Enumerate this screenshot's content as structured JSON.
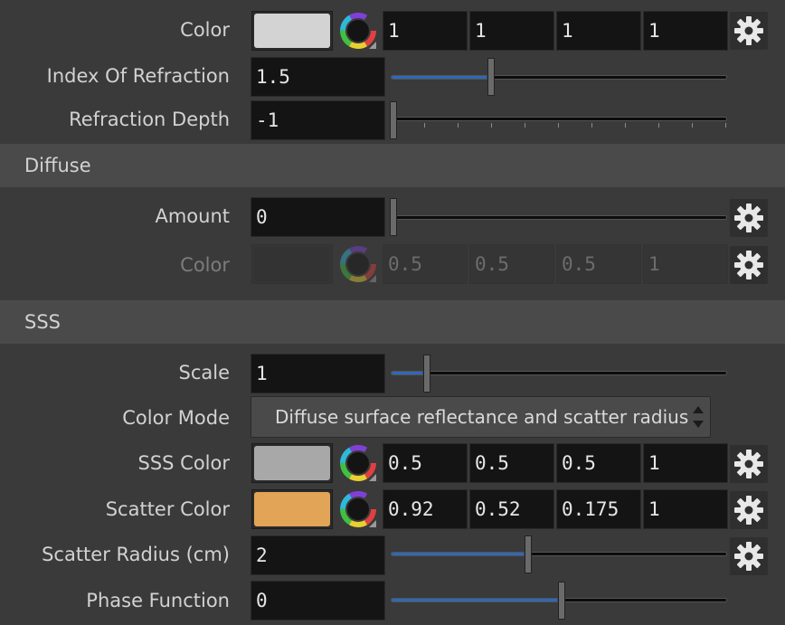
{
  "colors": {
    "field_bg": "#141414",
    "section_bg": "#4a4a4a",
    "slider_fill": "#2f68b8"
  },
  "refraction": {
    "color": {
      "label": "Color",
      "swatch": "#d3d3d3",
      "values": [
        "1",
        "1",
        "1",
        "1"
      ]
    },
    "ior": {
      "label": "Index Of Refraction",
      "value": "1.5",
      "slider_fraction": 0.29
    },
    "depth": {
      "label": "Refraction Depth",
      "value": "-1",
      "slider_fraction": 0.0
    }
  },
  "diffuse": {
    "section_title": "Diffuse",
    "amount": {
      "label": "Amount",
      "value": "0",
      "slider_fraction": 0.0
    },
    "color": {
      "label": "Color",
      "swatch": "#333333",
      "values": [
        "0.5",
        "0.5",
        "0.5",
        "1"
      ]
    }
  },
  "sss": {
    "section_title": "SSS",
    "scale": {
      "label": "Scale",
      "value": "1",
      "slider_fraction": 0.1
    },
    "color_mode": {
      "label": "Color Mode",
      "value": "Diffuse surface reflectance and scatter radius"
    },
    "sss_color": {
      "label": "SSS Color",
      "swatch": "#a8a8a8",
      "values": [
        "0.5",
        "0.5",
        "0.5",
        "1"
      ]
    },
    "scatter_color": {
      "label": "Scatter Color",
      "swatch": "#e2a456",
      "values": [
        "0.92",
        "0.52",
        "0.175",
        "1"
      ]
    },
    "scatter_radius": {
      "label": "Scatter Radius (cm)",
      "value": "2",
      "slider_fraction": 0.4
    },
    "phase_function": {
      "label": "Phase Function",
      "value": "0",
      "slider_fraction": 0.5
    }
  }
}
